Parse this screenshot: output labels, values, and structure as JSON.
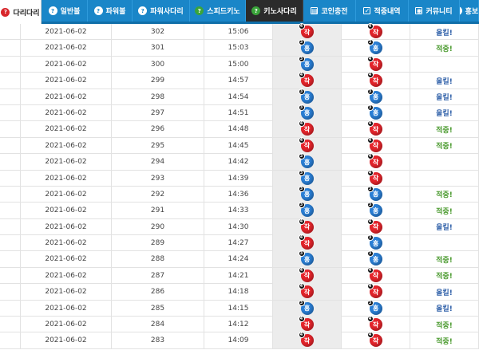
{
  "tabs": [
    {
      "label": "다리다리",
      "icon": "question-icon",
      "style": "active-home"
    },
    {
      "label": "일반볼",
      "icon": "question-icon",
      "style": "normal"
    },
    {
      "label": "파워볼",
      "icon": "question-icon",
      "style": "normal"
    },
    {
      "label": "파워사다리",
      "icon": "question-icon",
      "style": "normal"
    },
    {
      "label": "스피드키노",
      "icon": "question-icon",
      "style": "normal"
    },
    {
      "label": "키노사다리",
      "icon": "question-icon",
      "style": "dark"
    },
    {
      "label": "코인충전",
      "icon": "coin-icon",
      "style": "normal"
    },
    {
      "label": "적중내역",
      "icon": "chart-icon",
      "style": "normal"
    },
    {
      "label": "커뮤니티",
      "icon": "community-icon",
      "style": "normal"
    },
    {
      "label": "홍보코",
      "icon": "question-icon",
      "style": "normal"
    }
  ],
  "colors": {
    "red": "#e5242b",
    "blue": "#2a7fd6",
    "tab_bg": "#1a86c8",
    "hit": "#4a9a2e",
    "miss": "#2e5fa8"
  },
  "rows": [
    {
      "date": "2021-06-02",
      "round": "302",
      "time": "15:06",
      "pred": {
        "color": "red",
        "label": "작",
        "num": "4"
      },
      "actual": {
        "color": "red",
        "label": "작",
        "num": "4"
      },
      "result": "올킬!",
      "result_type": "no"
    },
    {
      "date": "2021-06-02",
      "round": "301",
      "time": "15:03",
      "pred": {
        "color": "blue",
        "label": "홍",
        "num": "3"
      },
      "actual": {
        "color": "blue",
        "label": "홍",
        "num": "3"
      },
      "result": "적중!",
      "result_type": "ok"
    },
    {
      "date": "2021-06-02",
      "round": "300",
      "time": "15:00",
      "pred": {
        "color": "blue",
        "label": "홍",
        "num": "3"
      },
      "actual": {
        "color": "red",
        "label": "작",
        "num": "4"
      },
      "result": "",
      "result_type": ""
    },
    {
      "date": "2021-06-02",
      "round": "299",
      "time": "14:57",
      "pred": {
        "color": "red",
        "label": "작",
        "num": "4"
      },
      "actual": {
        "color": "red",
        "label": "작",
        "num": "4"
      },
      "result": "올킬!",
      "result_type": "no"
    },
    {
      "date": "2021-06-02",
      "round": "298",
      "time": "14:54",
      "pred": {
        "color": "blue",
        "label": "홍",
        "num": "3"
      },
      "actual": {
        "color": "blue",
        "label": "홍",
        "num": "3"
      },
      "result": "올킬!",
      "result_type": "no"
    },
    {
      "date": "2021-06-02",
      "round": "297",
      "time": "14:51",
      "pred": {
        "color": "blue",
        "label": "홍",
        "num": "3"
      },
      "actual": {
        "color": "blue",
        "label": "홍",
        "num": "3"
      },
      "result": "올킬!",
      "result_type": "no"
    },
    {
      "date": "2021-06-02",
      "round": "296",
      "time": "14:48",
      "pred": {
        "color": "red",
        "label": "작",
        "num": "4"
      },
      "actual": {
        "color": "red",
        "label": "작",
        "num": "4"
      },
      "result": "적중!",
      "result_type": "ok"
    },
    {
      "date": "2021-06-02",
      "round": "295",
      "time": "14:45",
      "pred": {
        "color": "red",
        "label": "작",
        "num": "4"
      },
      "actual": {
        "color": "red",
        "label": "작",
        "num": "4"
      },
      "result": "적중!",
      "result_type": "ok"
    },
    {
      "date": "2021-06-02",
      "round": "294",
      "time": "14:42",
      "pred": {
        "color": "blue",
        "label": "홍",
        "num": "3"
      },
      "actual": {
        "color": "red",
        "label": "작",
        "num": "4"
      },
      "result": "",
      "result_type": ""
    },
    {
      "date": "2021-06-02",
      "round": "293",
      "time": "14:39",
      "pred": {
        "color": "blue",
        "label": "홍",
        "num": "3"
      },
      "actual": {
        "color": "red",
        "label": "작",
        "num": "4"
      },
      "result": "",
      "result_type": ""
    },
    {
      "date": "2021-06-02",
      "round": "292",
      "time": "14:36",
      "pred": {
        "color": "blue",
        "label": "홍",
        "num": "3"
      },
      "actual": {
        "color": "blue",
        "label": "홍",
        "num": "3"
      },
      "result": "적중!",
      "result_type": "ok"
    },
    {
      "date": "2021-06-02",
      "round": "291",
      "time": "14:33",
      "pred": {
        "color": "blue",
        "label": "홍",
        "num": "3"
      },
      "actual": {
        "color": "blue",
        "label": "홍",
        "num": "3"
      },
      "result": "적중!",
      "result_type": "ok"
    },
    {
      "date": "2021-06-02",
      "round": "290",
      "time": "14:30",
      "pred": {
        "color": "red",
        "label": "작",
        "num": "4"
      },
      "actual": {
        "color": "red",
        "label": "작",
        "num": "4"
      },
      "result": "올킬!",
      "result_type": "no"
    },
    {
      "date": "2021-06-02",
      "round": "289",
      "time": "14:27",
      "pred": {
        "color": "red",
        "label": "작",
        "num": "4"
      },
      "actual": {
        "color": "blue",
        "label": "홍",
        "num": "3"
      },
      "result": "",
      "result_type": ""
    },
    {
      "date": "2021-06-02",
      "round": "288",
      "time": "14:24",
      "pred": {
        "color": "blue",
        "label": "홍",
        "num": "3"
      },
      "actual": {
        "color": "blue",
        "label": "홍",
        "num": "3"
      },
      "result": "적중!",
      "result_type": "ok"
    },
    {
      "date": "2021-06-02",
      "round": "287",
      "time": "14:21",
      "pred": {
        "color": "red",
        "label": "작",
        "num": "4"
      },
      "actual": {
        "color": "red",
        "label": "작",
        "num": "4"
      },
      "result": "적중!",
      "result_type": "ok"
    },
    {
      "date": "2021-06-02",
      "round": "286",
      "time": "14:18",
      "pred": {
        "color": "red",
        "label": "작",
        "num": "4"
      },
      "actual": {
        "color": "red",
        "label": "작",
        "num": "4"
      },
      "result": "올킬!",
      "result_type": "no"
    },
    {
      "date": "2021-06-02",
      "round": "285",
      "time": "14:15",
      "pred": {
        "color": "blue",
        "label": "홍",
        "num": "3"
      },
      "actual": {
        "color": "blue",
        "label": "홍",
        "num": "3"
      },
      "result": "올킬!",
      "result_type": "no"
    },
    {
      "date": "2021-06-02",
      "round": "284",
      "time": "14:12",
      "pred": {
        "color": "red",
        "label": "작",
        "num": "4"
      },
      "actual": {
        "color": "red",
        "label": "작",
        "num": "4"
      },
      "result": "적중!",
      "result_type": "ok"
    },
    {
      "date": "2021-06-02",
      "round": "283",
      "time": "14:09",
      "pred": {
        "color": "red",
        "label": "작",
        "num": "4"
      },
      "actual": {
        "color": "red",
        "label": "작",
        "num": "4"
      },
      "result": "적중!",
      "result_type": "ok"
    }
  ]
}
